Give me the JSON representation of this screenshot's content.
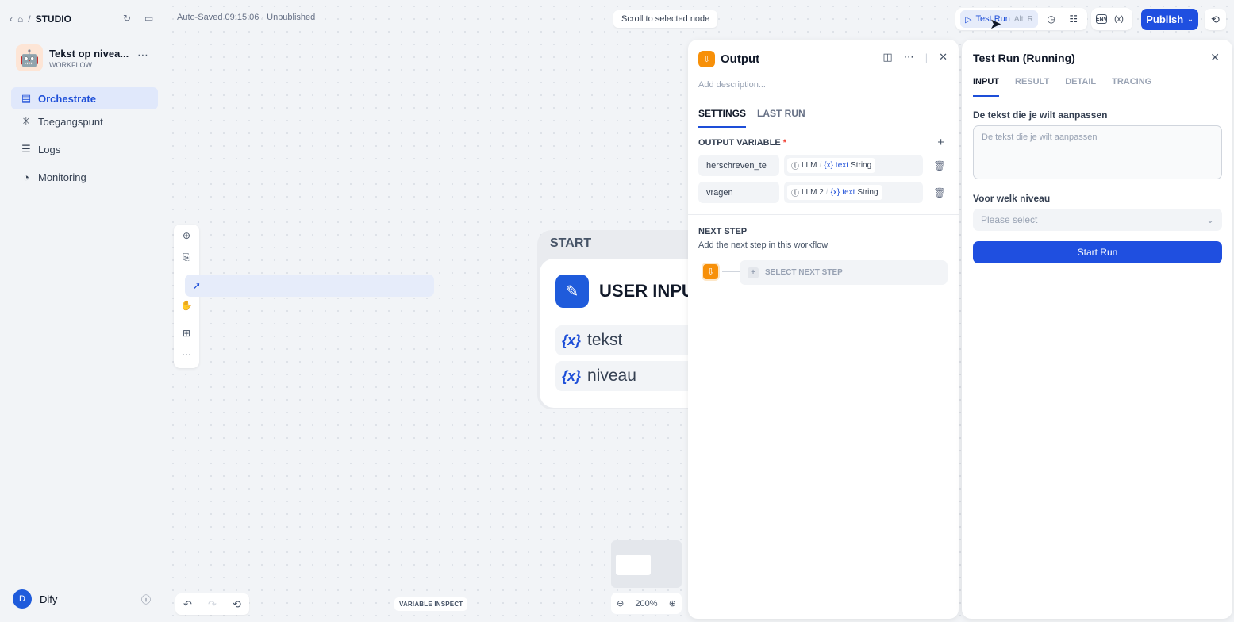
{
  "breadcrumb": {
    "section": "STUDIO"
  },
  "app": {
    "name": "Tekst op nivea...",
    "type": "WORKFLOW",
    "emoji": "🤖"
  },
  "nav": [
    {
      "label": "Orchestrate",
      "icon": "orchestrate-icon"
    },
    {
      "label": "Toegangspunt",
      "icon": "access-point-icon"
    },
    {
      "label": "Logs",
      "icon": "logs-icon"
    },
    {
      "label": "Monitoring",
      "icon": "monitoring-icon"
    }
  ],
  "user": {
    "initial": "D",
    "name": "Dify"
  },
  "topbar": {
    "status": "Auto-Saved 09:15:06 · Unpublished",
    "scroll_btn": "Scroll to selected node",
    "test_run": "Test Run",
    "kbd_alt": "Alt",
    "kbd_r": "R",
    "publish": "Publish",
    "env_label": "ENV"
  },
  "canvas": {
    "variable_inspect": "VARIABLE INSPECT",
    "zoom": "200%"
  },
  "start_node": {
    "label": "START",
    "title": "USER INPUT",
    "vars": [
      "tekst",
      "niveau"
    ]
  },
  "output_panel": {
    "title": "Output",
    "description_placeholder": "Add description...",
    "tabs": [
      "SETTINGS",
      "LAST RUN"
    ],
    "section_label": "OUTPUT VARIABLE",
    "required_mark": "*",
    "variables": [
      {
        "name": "herschreven_te",
        "node": "LLM",
        "var": "text",
        "type": "String"
      },
      {
        "name": "vragen",
        "node": "LLM 2",
        "var": "text",
        "type": "String"
      }
    ],
    "next_step": {
      "title": "NEXT STEP",
      "desc": "Add the next step in this workflow",
      "button": "SELECT NEXT STEP"
    }
  },
  "test_run_panel": {
    "title": "Test Run (Running)",
    "tabs": [
      "INPUT",
      "RESULT",
      "DETAIL",
      "TRACING"
    ],
    "field1_label": "De tekst die je wilt aanpassen",
    "field1_placeholder": "De tekst die je wilt aanpassen",
    "field2_label": "Voor welk niveau",
    "field2_placeholder": "Please select",
    "start_button": "Start Run"
  },
  "colors": {
    "accent": "#1f4fe0",
    "output_node": "#f79009",
    "start_icon": "#1f5bdb"
  }
}
